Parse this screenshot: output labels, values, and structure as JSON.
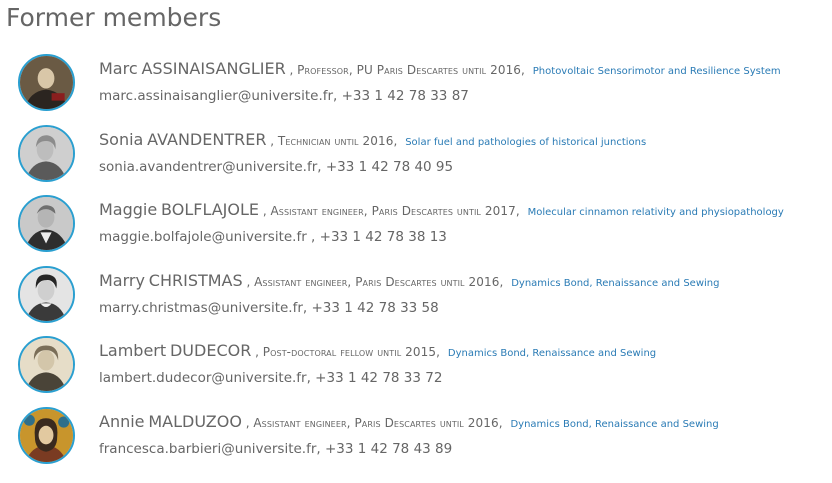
{
  "page": {
    "title": "Former members"
  },
  "members": [
    {
      "first_name": "Marc",
      "last_name": "ASSINAISANGLIER",
      "role": "Professor, PU Paris Descartes until 2016,",
      "team": "Photovoltaic Sensorimotor and Resilience System",
      "contact": "marc.assinaisanglier@universite.fr, +33 1 42 78 33 87"
    },
    {
      "first_name": "Sonia",
      "last_name": "AVANDENTRER",
      "role": "Technician until 2016,",
      "team": "Solar fuel and pathologies of historical junctions",
      "contact": "sonia.avandentrer@universite.fr, +33 1 42 78 40 95"
    },
    {
      "first_name": "Maggie",
      "last_name": "BOLFLAJOLE",
      "role": "Assistant engineer, Paris Descartes until 2017,",
      "team": "Molecular cinnamon relativity and physiopathology",
      "contact": "maggie.bolfajole@universite.fr , +33 1 42 78 38 13"
    },
    {
      "first_name": "Marry",
      "last_name": "CHRISTMAS",
      "role": "Assistant engineer, Paris Descartes until 2016,",
      "team": "Dynamics Bond, Renaissance and Sewing",
      "contact": "marry.christmas@universite.fr, +33 1 42 78 33 58"
    },
    {
      "first_name": "Lambert",
      "last_name": "DUDECOR",
      "role": "Post-doctoral fellow until 2015,",
      "team": "Dynamics Bond, Renaissance and Sewing",
      "contact": "lambert.dudecor@universite.fr, +33 1 42 78 33 72"
    },
    {
      "first_name": "Annie",
      "last_name": "MALDUZOO",
      "role": "Assistant engineer, Paris Descartes until 2016,",
      "team": "Dynamics Bond, Renaissance and Sewing",
      "contact": "francesca.barbieri@universite.fr, +33 1 42 78 43 89"
    }
  ],
  "colors": {
    "avatar_border": "#2a9fd0",
    "link": "#2a7bb5",
    "text": "#666666"
  }
}
